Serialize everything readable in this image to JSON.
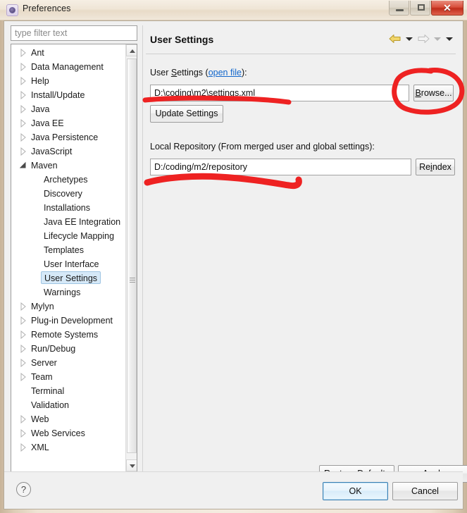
{
  "window": {
    "title": "Preferences",
    "icon": "preferences-gear-icon",
    "controls": {
      "minimize": "minimize",
      "maximize": "restore",
      "close": "close"
    }
  },
  "sidebar": {
    "filter_placeholder": "type filter text",
    "filter_value": "",
    "items": [
      {
        "label": "Ant",
        "level": 1,
        "state": "collapsed"
      },
      {
        "label": "Data Management",
        "level": 1,
        "state": "collapsed"
      },
      {
        "label": "Help",
        "level": 1,
        "state": "collapsed"
      },
      {
        "label": "Install/Update",
        "level": 1,
        "state": "collapsed"
      },
      {
        "label": "Java",
        "level": 1,
        "state": "collapsed"
      },
      {
        "label": "Java EE",
        "level": 1,
        "state": "collapsed"
      },
      {
        "label": "Java Persistence",
        "level": 1,
        "state": "collapsed"
      },
      {
        "label": "JavaScript",
        "level": 1,
        "state": "collapsed"
      },
      {
        "label": "Maven",
        "level": 1,
        "state": "expanded"
      },
      {
        "label": "Archetypes",
        "level": 2,
        "state": "leaf"
      },
      {
        "label": "Discovery",
        "level": 2,
        "state": "leaf"
      },
      {
        "label": "Installations",
        "level": 2,
        "state": "leaf"
      },
      {
        "label": "Java EE Integration",
        "level": 2,
        "state": "leaf"
      },
      {
        "label": "Lifecycle Mapping",
        "level": 2,
        "state": "leaf"
      },
      {
        "label": "Templates",
        "level": 2,
        "state": "leaf"
      },
      {
        "label": "User Interface",
        "level": 2,
        "state": "leaf"
      },
      {
        "label": "User Settings",
        "level": 2,
        "state": "leaf",
        "selected": true
      },
      {
        "label": "Warnings",
        "level": 2,
        "state": "leaf"
      },
      {
        "label": "Mylyn",
        "level": 1,
        "state": "collapsed"
      },
      {
        "label": "Plug-in Development",
        "level": 1,
        "state": "collapsed"
      },
      {
        "label": "Remote Systems",
        "level": 1,
        "state": "collapsed"
      },
      {
        "label": "Run/Debug",
        "level": 1,
        "state": "collapsed"
      },
      {
        "label": "Server",
        "level": 1,
        "state": "collapsed"
      },
      {
        "label": "Team",
        "level": 1,
        "state": "collapsed"
      },
      {
        "label": "Terminal",
        "level": 1,
        "state": "leaf"
      },
      {
        "label": "Validation",
        "level": 1,
        "state": "leaf"
      },
      {
        "label": "Web",
        "level": 1,
        "state": "collapsed"
      },
      {
        "label": "Web Services",
        "level": 1,
        "state": "collapsed"
      },
      {
        "label": "XML",
        "level": 1,
        "state": "collapsed"
      }
    ]
  },
  "page": {
    "title": "User Settings",
    "nav": {
      "back": "back-arrow",
      "back_menu": "back-dropdown",
      "forward": "forward-arrow",
      "forward_menu": "forward-dropdown",
      "view_menu": "view-menu"
    },
    "user_settings": {
      "label_prefix": "User ",
      "label_mnemonic": "S",
      "label_suffix": "ettings (",
      "link_text": "open file",
      "label_end": "):",
      "value": "D:\\coding\\m2\\settings.xml",
      "browse_mnemonic": "B",
      "browse_rest": "rowse...",
      "update_button": "Update Settings"
    },
    "local_repository": {
      "label": "Local Repository (From merged user and global settings):",
      "value": "D:/coding/m2/repository",
      "reindex_prefix": "Re",
      "reindex_mnemonic": "i",
      "reindex_suffix": "ndex"
    },
    "restore_defaults": {
      "prefix": "Restore ",
      "mnemonic": "D",
      "suffix": "efaults"
    },
    "apply": {
      "mnemonic": "A",
      "suffix": "pply"
    }
  },
  "footer": {
    "help_icon": "?",
    "ok": "OK",
    "cancel": "Cancel"
  },
  "annotations": {
    "color": "#ee2222",
    "marks": [
      "underline-settings-path",
      "circle-browse-button",
      "underline-repository-path"
    ]
  }
}
